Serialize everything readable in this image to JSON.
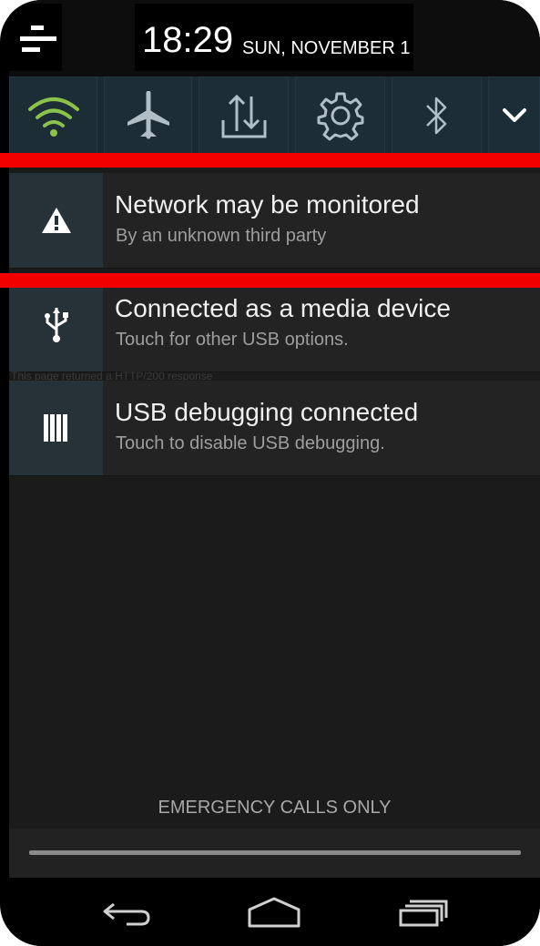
{
  "status_bar": {
    "time": "18:29",
    "date": "SUN, NOVEMBER 1",
    "menu_icon": "menu-icon"
  },
  "quick_settings": {
    "tiles": [
      {
        "name": "wifi",
        "icon": "wifi-icon",
        "color": "#8bc34a"
      },
      {
        "name": "airplane-mode",
        "icon": "airplane-icon",
        "color": "#b0bec5"
      },
      {
        "name": "data-transfer",
        "icon": "upload-icon",
        "color": "#b0bec5"
      },
      {
        "name": "settings",
        "icon": "gear-icon",
        "color": "#b0bec5"
      },
      {
        "name": "bluetooth",
        "icon": "bluetooth-icon",
        "color": "#b0bec5"
      },
      {
        "name": "expand",
        "icon": "chevron-down-icon",
        "color": "#ffffff"
      }
    ]
  },
  "notifications": [
    {
      "title": "Network may be monitored",
      "subtitle": "By an unknown third party",
      "icon": "warning-icon"
    },
    {
      "title": "Connected as a media device",
      "subtitle": "Touch for other USB options.",
      "icon": "usb-icon"
    },
    {
      "title": "USB debugging connected",
      "subtitle": "Touch to disable USB debugging.",
      "icon": "debug-bars-icon"
    }
  ],
  "ghost_text": {
    "line1": "This page returned a HTTP/200 response"
  },
  "footer": {
    "emergency": "EMERGENCY CALLS ONLY"
  },
  "nav": {
    "back_icon": "back-icon",
    "home_icon": "home-icon",
    "recents_icon": "recents-icon"
  },
  "colors": {
    "accent_wifi": "#8bc34a",
    "redaction_bar": "#f20000",
    "icon_tile": "#263238"
  }
}
